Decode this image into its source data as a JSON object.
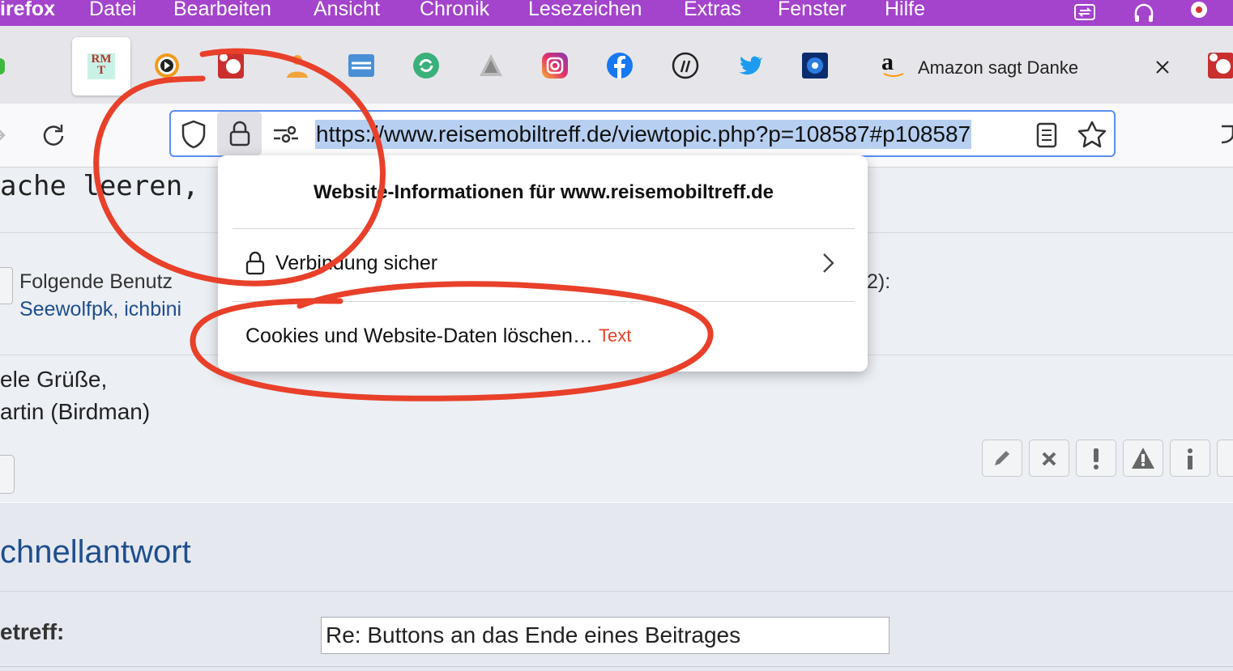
{
  "menubar": {
    "app_name": "irefox",
    "items": [
      "Datei",
      "Bearbeiten",
      "Ansicht",
      "Chronik",
      "Lesezeichen",
      "Extras",
      "Fenster",
      "Hilfe"
    ]
  },
  "pinned_tabs": [
    {
      "name": "rmt-favicon",
      "text": "RM T"
    },
    {
      "name": "plex-favicon"
    },
    {
      "name": "red-dot-favicon"
    },
    {
      "name": "orange-favicon"
    },
    {
      "name": "globe-favicon"
    },
    {
      "name": "green-sync-favicon"
    },
    {
      "name": "grey-favicon"
    },
    {
      "name": "instagram-favicon"
    },
    {
      "name": "facebook-favicon"
    },
    {
      "name": "wordpress-favicon"
    },
    {
      "name": "twitter-favicon"
    },
    {
      "name": "blue-globe-favicon"
    }
  ],
  "active_tab": {
    "title": "Amazon sagt Danke",
    "favicon": "a"
  },
  "urlbar": {
    "url": "https://www.reisemobiltreff.de/viewtopic.php?p=108587#p108587"
  },
  "page": {
    "line1": "ache leeren, s. m",
    "thanks_prefix": "Folgende Benutz",
    "thanks_count": "2):",
    "thanks_users": "Seewolfpk, ichbini",
    "greeting1": "ele Grüße,",
    "greeting2": "artin (Birdman)",
    "quick_reply": "chnellantwort",
    "subject_label": "etreff:",
    "subject_value": "Re: Buttons an das Ende eines Beitrages"
  },
  "popup": {
    "title": "Website-Informationen für www.reisemobiltreff.de",
    "connection": "Verbindung sicher",
    "clear": "Cookies und Website-Daten löschen…"
  },
  "annotation": {
    "label": "Text",
    "color": "#e8402a"
  },
  "colors": {
    "menubar": "#a443cc",
    "accent": "#5b8ef0",
    "link": "#1f4e8f"
  }
}
